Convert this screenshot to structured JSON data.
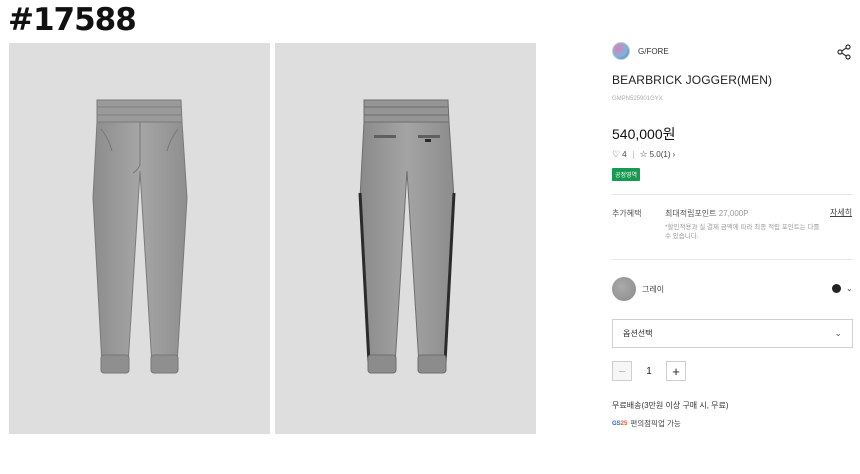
{
  "page_id": "#17588",
  "brand": {
    "name": "G/FORE"
  },
  "product": {
    "title": "BEARBRICK JOGGER(MEN)",
    "code": "GMPN525901GYX",
    "price": "540,000원",
    "likes": "4",
    "rating": "5.0(1)",
    "badge": "공정영역"
  },
  "benefit": {
    "label": "추가혜택",
    "points_label": "최대적립포인트",
    "points_value": "27,000P",
    "detail_link": "자세히",
    "note": "*할인적용과 실 결제 금액에 따라 최종 적립 포인트는 다를 수 있습니다."
  },
  "color": {
    "name": "그레이",
    "selected_hex": "#222222"
  },
  "option": {
    "placeholder": "옵션선택"
  },
  "quantity": {
    "value": "1",
    "minus": "−",
    "plus": "+"
  },
  "shipping": {
    "text": "무료배송(3만원 이상 구매 시, 무료)",
    "pickup_logo_a": "GS",
    "pickup_logo_b": "25",
    "pickup_text": "편의점픽업 가능"
  },
  "colors": {
    "accent_badge": "#169a52",
    "photo_bg": "#dedede"
  },
  "icons": {
    "share": "share-icon",
    "heart": "heart-icon",
    "star": "star-icon",
    "chevron": "chevron-down-icon"
  }
}
